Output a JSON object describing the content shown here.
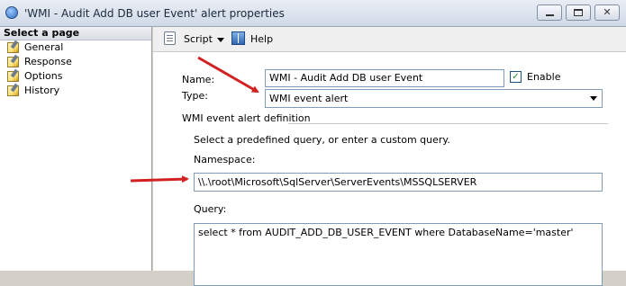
{
  "window": {
    "title": "'WMI - Audit Add DB user Event' alert properties",
    "minimize_icon": "minimize-icon",
    "maximize_icon": "maximize-icon",
    "close_glyph": "✕"
  },
  "sidebar": {
    "header": "Select a page",
    "items": [
      {
        "label": "General",
        "icon": "page-wrench-icon"
      },
      {
        "label": "Response",
        "icon": "page-wrench-icon"
      },
      {
        "label": "Options",
        "icon": "page-wrench-icon"
      },
      {
        "label": "History",
        "icon": "page-wrench-icon"
      }
    ]
  },
  "toolbar": {
    "script_label": "Script",
    "help_label": "Help"
  },
  "form": {
    "name_label": "Name:",
    "name_value": "WMI - Audit Add DB user Event",
    "enable_label": "Enable",
    "enable_checked": true,
    "type_label": "Type:",
    "type_value": "WMI event alert",
    "group_title": "WMI event alert definition",
    "instructions": "Select a predefined query, or enter a custom query.",
    "namespace_label": "Namespace:",
    "namespace_value": "\\\\.\\root\\Microsoft\\SqlServer\\ServerEvents\\MSSQLSERVER",
    "query_label": "Query:",
    "query_value": "select *  from AUDIT_ADD_DB_USER_EVENT where DatabaseName='master'"
  },
  "colors": {
    "annotation_arrow": "#d22121",
    "field_border": "#7f9db9"
  }
}
